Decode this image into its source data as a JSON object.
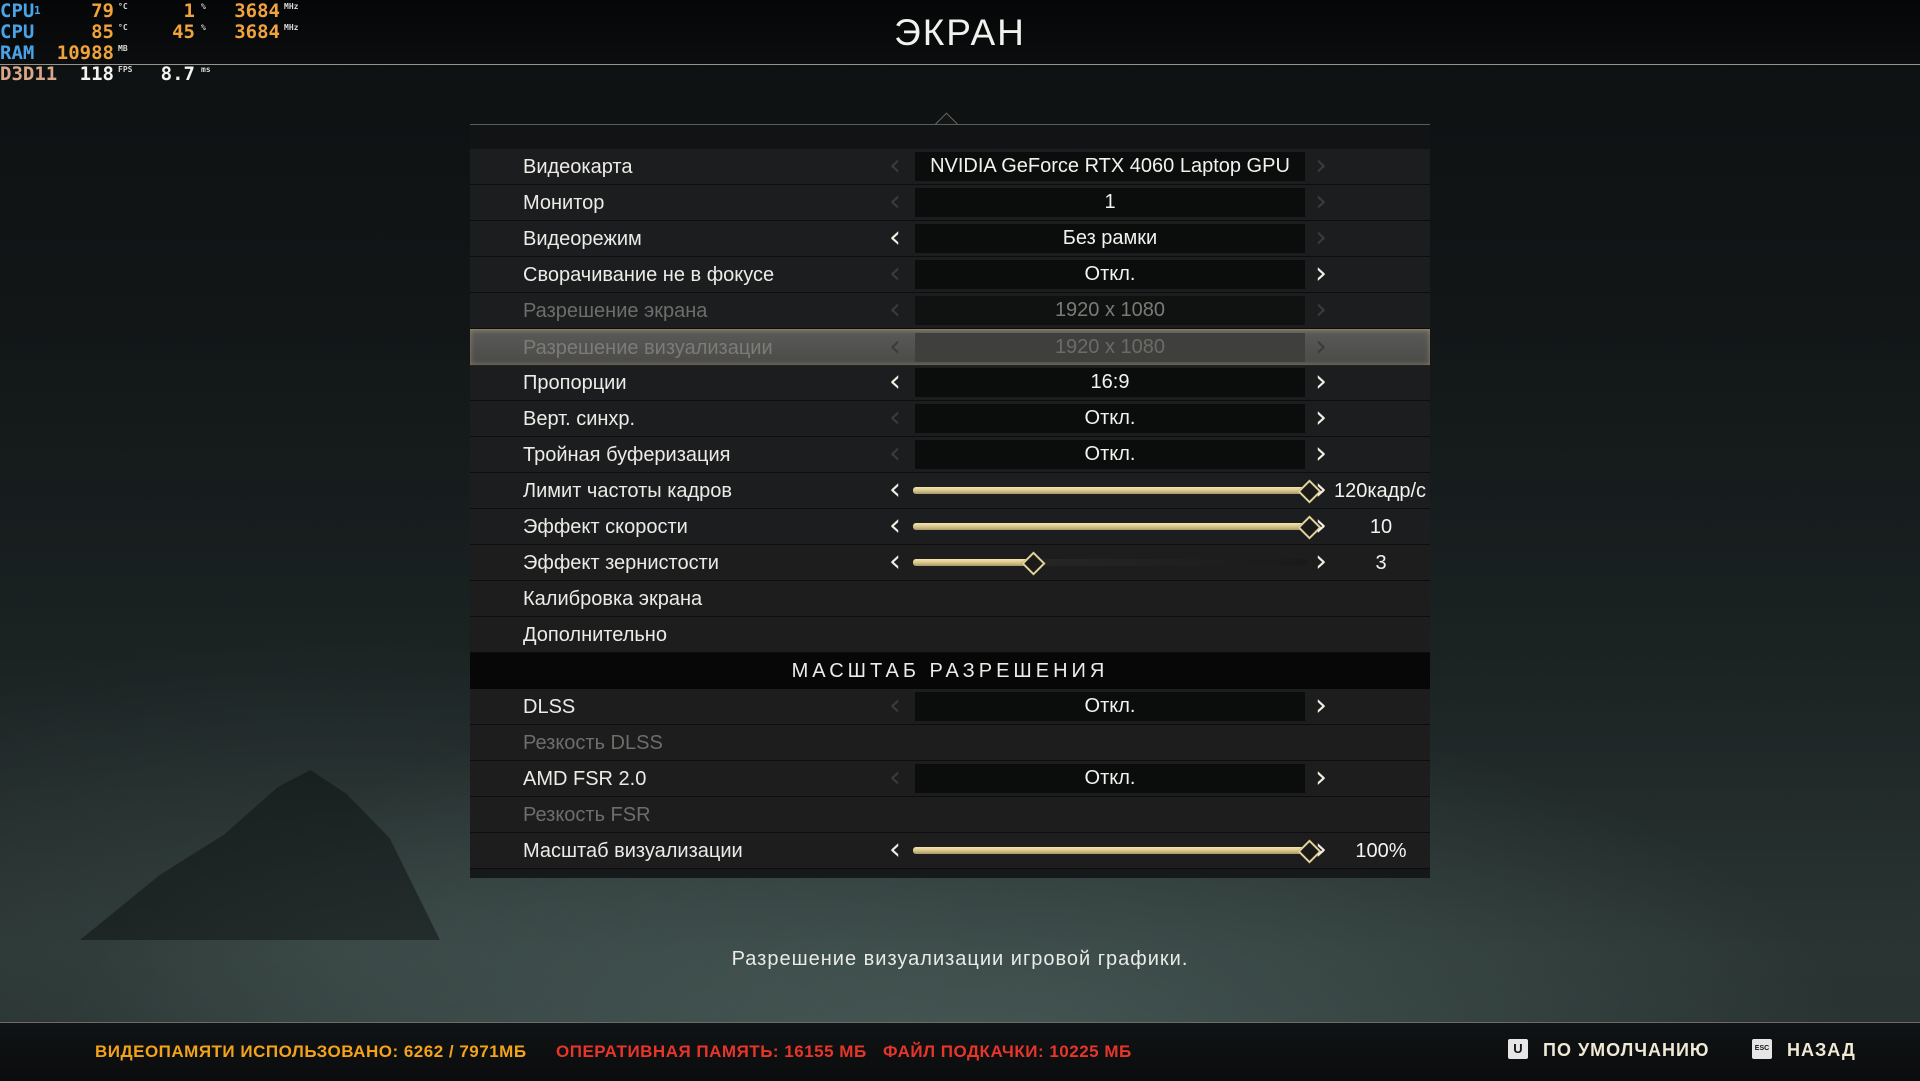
{
  "page": {
    "title": "ЭКРАН"
  },
  "osd": {
    "rows": [
      {
        "label": "CPU",
        "label_sub": "1",
        "temp": "79",
        "temp_unit": "°C",
        "load": "1",
        "load_unit": "%",
        "clock": "3684",
        "clock_unit": "MHz"
      },
      {
        "label": "CPU",
        "temp": "85",
        "temp_unit": "°C",
        "load": "45",
        "load_unit": "%",
        "clock": "3684",
        "clock_unit": "MHz"
      },
      {
        "label": "RAM",
        "value": "10988",
        "value_unit": "MB"
      },
      {
        "label": "D3D11",
        "fps": "118",
        "fps_unit": "FPS",
        "frametime": "8.7",
        "frametime_unit": "ms"
      }
    ]
  },
  "settings": {
    "rows": [
      {
        "label": "Видеокарта",
        "value": "NVIDIA GeForce RTX 4060 Laptop GPU"
      },
      {
        "label": "Монитор",
        "value": "1"
      },
      {
        "label": "Видеорежим",
        "value": "Без рамки"
      },
      {
        "label": "Сворачивание не в фокусе",
        "value": "Откл."
      },
      {
        "label": "Разрешение экрана",
        "value": "1920 x 1080"
      },
      {
        "label": "Разрешение визуализации",
        "value": "1920 x 1080"
      },
      {
        "label": "Пропорции",
        "value": "16:9"
      },
      {
        "label": "Верт. синхр.",
        "value": "Откл."
      },
      {
        "label": "Тройная буферизация",
        "value": "Откл."
      },
      {
        "label": "Лимит частоты кадров",
        "value": "120кадр/с",
        "level": 1.0
      },
      {
        "label": "Эффект скорости",
        "value": "10",
        "level": 1.0
      },
      {
        "label": "Эффект зернистости",
        "value": "3",
        "level": 0.3
      },
      {
        "label": "Калибровка экрана"
      },
      {
        "label": "Дополнительно"
      }
    ],
    "section_title": "МАСШТАБ РАЗРЕШЕНИЯ",
    "scale_rows": [
      {
        "label": "DLSS",
        "value": "Откл."
      },
      {
        "label": "Резкость DLSS"
      },
      {
        "label": "AMD FSR 2.0",
        "value": "Откл."
      },
      {
        "label": "Резкость FSR"
      },
      {
        "label": "Масштаб визуализации",
        "value": "100%",
        "level": 1.0
      }
    ]
  },
  "arrows": {
    "left": "‹",
    "right": "›"
  },
  "hint": "Разрешение визуализации игровой графики.",
  "footer": {
    "vram": "ВИДЕОПАМЯТИ ИСПОЛЬЗОВАНО: 6262 / 7971МБ",
    "ram": "ОПЕРАТИВНАЯ ПАМЯТЬ: 16155 МБ",
    "swap": "ФАЙЛ ПОДКАЧКИ: 10225 МБ",
    "default_key": "U",
    "default_label": "ПО УМОЛЧАНИЮ",
    "back_key": "ESC",
    "back_label": "НАЗАД"
  },
  "colors": {
    "vram": "#f3a21c",
    "ram": "#e8352a",
    "accent": "#e2d39c"
  }
}
